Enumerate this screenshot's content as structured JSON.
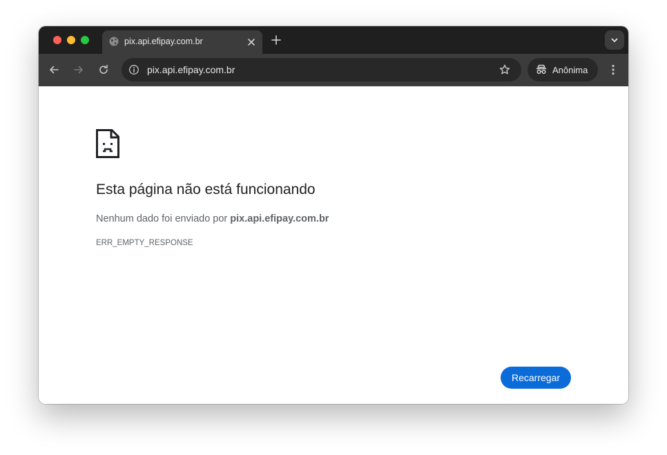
{
  "colors": {
    "tab_strip": "#1f1f1f",
    "toolbar": "#3c3c3c",
    "omnibox": "#282828",
    "accent": "#0b6bd9"
  },
  "tab": {
    "title": "pix.api.efipay.com.br",
    "icon": "globe-icon"
  },
  "toolbar": {
    "url": "pix.api.efipay.com.br",
    "incognito_label": "Anônima"
  },
  "error": {
    "icon": "sad-page-icon",
    "title": "Esta página não está funcionando",
    "description_prefix": "Nenhum dado foi enviado por ",
    "description_host": "pix.api.efipay.com.br",
    "code": "ERR_EMPTY_RESPONSE",
    "reload_label": "Recarregar"
  }
}
